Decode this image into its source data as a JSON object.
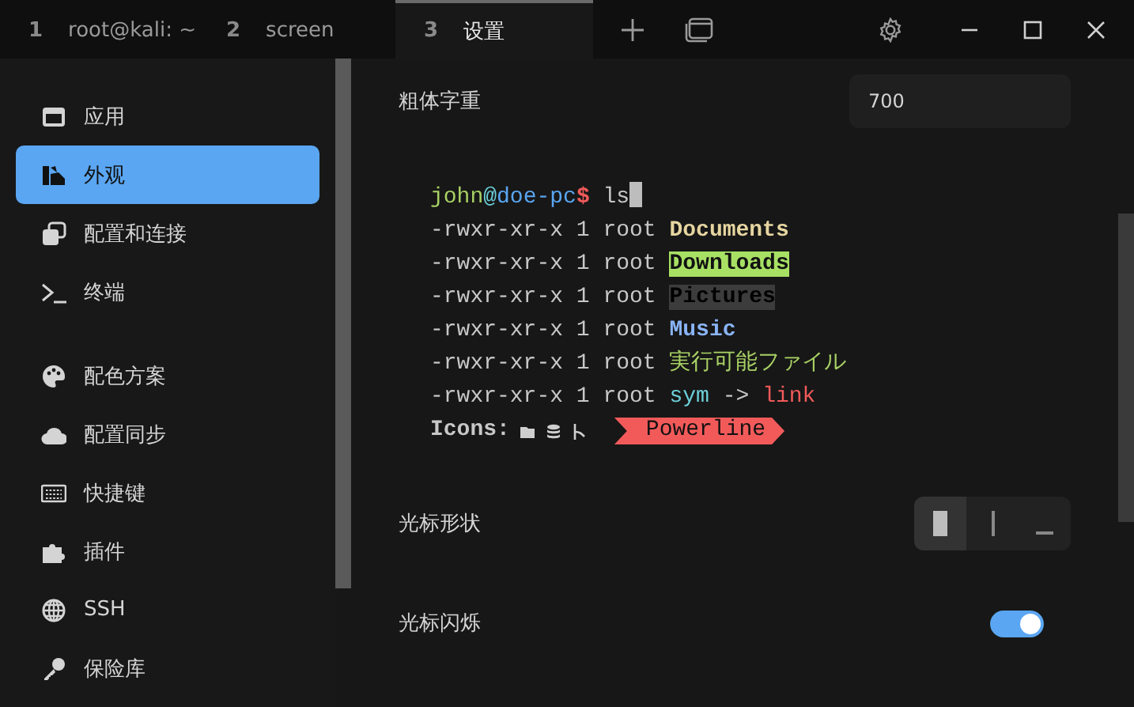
{
  "tabs": [
    {
      "number": "1",
      "label": "root@kali: ~",
      "selected": false
    },
    {
      "number": "2",
      "label": "screen",
      "selected": false
    },
    {
      "number": "3",
      "label": "设置",
      "selected": true
    }
  ],
  "sidebar": {
    "groups": [
      {
        "items": [
          {
            "label": "应用",
            "selected": false
          },
          {
            "label": "外观",
            "selected": true
          },
          {
            "label": "配置和连接",
            "selected": false
          },
          {
            "label": "终端",
            "selected": false
          }
        ]
      },
      {
        "items": [
          {
            "label": "配色方案",
            "selected": false
          },
          {
            "label": "配置同步",
            "selected": false
          },
          {
            "label": "快捷键",
            "selected": false
          },
          {
            "label": "插件",
            "selected": false
          },
          {
            "label": "SSH",
            "selected": false
          },
          {
            "label": "保险库",
            "selected": false
          }
        ]
      }
    ]
  },
  "bold_weight": {
    "label": "粗体字重",
    "value": "700"
  },
  "preview": {
    "prompt": {
      "user": "john",
      "at": "@",
      "host": "doe-pc",
      "sign": "$",
      "command": "ls"
    },
    "lines": [
      {
        "prefix": "-rwxr-xr-x 1 root",
        "name": "Documents",
        "kind": "dir"
      },
      {
        "prefix": "-rwxr-xr-x 1 root",
        "name": "Downloads",
        "kind": "highlight"
      },
      {
        "prefix": "-rwxr-xr-x 1 root",
        "name": "Pictures",
        "kind": "hidden"
      },
      {
        "prefix": "-rwxr-xr-x 1 root",
        "name": "Music",
        "kind": "music"
      },
      {
        "prefix": "-rwxr-xr-x 1 root",
        "name": "実行可能ファイル",
        "kind": "exec"
      },
      {
        "prefix": "-rwxr-xr-x 1 root",
        "name": "sym",
        "kind": "symlink",
        "arrow": "->",
        "target": "link"
      }
    ],
    "icons_label": "Icons:",
    "powerline": "Powerline"
  },
  "cursor_shape": {
    "label": "光标形状",
    "options": [
      {
        "kind": "block",
        "selected": true
      },
      {
        "kind": "bar",
        "selected": false
      },
      {
        "kind": "underline",
        "selected": false
      }
    ]
  },
  "cursor_blink": {
    "label": "光标闪烁",
    "on": true
  }
}
